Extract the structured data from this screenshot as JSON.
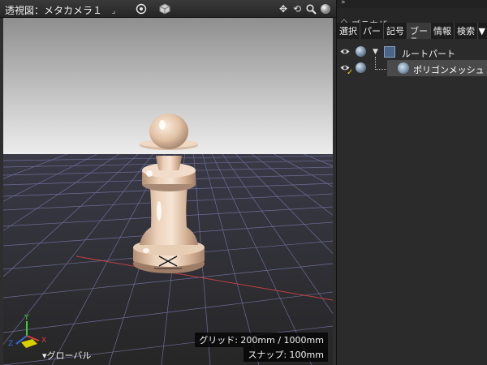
{
  "viewport": {
    "title": "透視図：メタカメラ１",
    "grid_info": "グリッド: 200mm / 1000mm",
    "snap_info": "スナップ: 100mm",
    "axis_mode": "▾グローバル",
    "axes": {
      "x": "X",
      "y": "Y",
      "z": "Z"
    },
    "toolbar_icons": [
      "dropdown-corner-icon",
      "target-icon",
      "cube-icon",
      "move-icon",
      "rotate-icon",
      "zoom-icon",
      "sphere-icon"
    ]
  },
  "browser": {
    "collapse_glyph": "»",
    "title": "ブラウザ",
    "tabs": [
      {
        "label": "選択",
        "active": false
      },
      {
        "label": "パー",
        "active": false
      },
      {
        "label": "記号",
        "active": false
      },
      {
        "label": "ブー",
        "active": true
      },
      {
        "label": "情報",
        "active": false
      },
      {
        "label": "検索",
        "active": false
      }
    ],
    "tab_menu": "▼",
    "tree": [
      {
        "label": "ルートパート",
        "type": "part"
      },
      {
        "label": "ポリゴンメッシュ",
        "type": "polygon-mesh",
        "selected": true
      }
    ]
  },
  "colors": {
    "sky_top": "#9a9a9a",
    "sky_bottom": "#ededed",
    "floor": "#2b2b2b",
    "grid_line": "#6a6a90",
    "pawn": "#e3c3a8",
    "axis_x": "#e03a3a",
    "axis_y": "#3ad13a",
    "axis_z": "#3a6ae0"
  }
}
